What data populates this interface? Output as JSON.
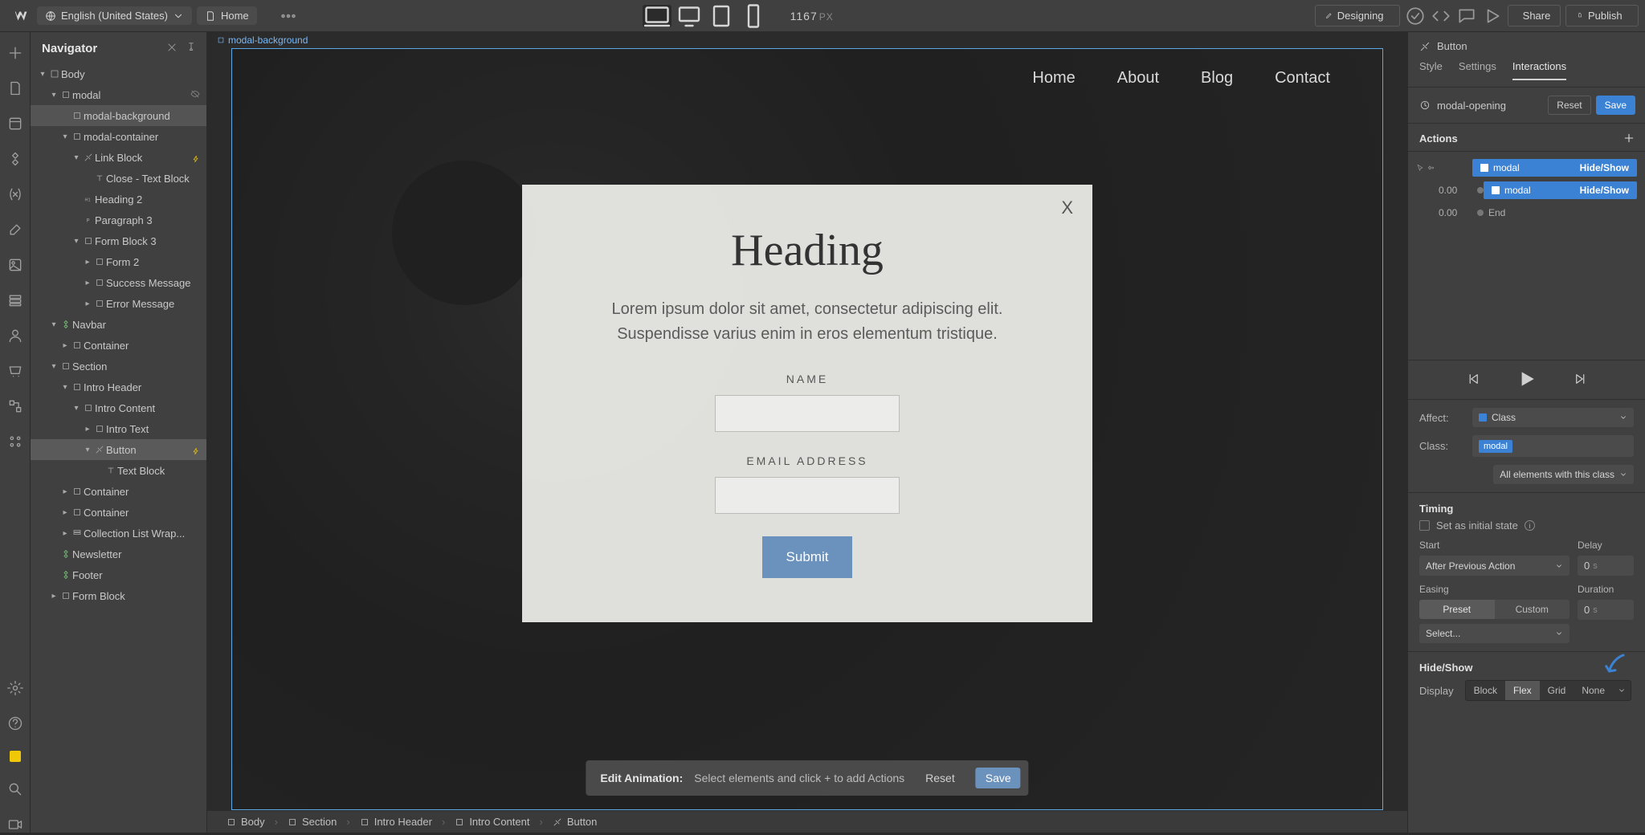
{
  "topbar": {
    "locale": "English (United States)",
    "page": "Home",
    "viewport_px": "1167",
    "viewport_unit": "PX",
    "mode": "Designing",
    "share": "Share",
    "publish": "Publish"
  },
  "navigator": {
    "title": "Navigator"
  },
  "tree": [
    {
      "d": 0,
      "tw": "v",
      "icon": "body",
      "label": "Body"
    },
    {
      "d": 1,
      "tw": "v",
      "icon": "div",
      "label": "modal",
      "eye": true
    },
    {
      "d": 2,
      "tw": "",
      "icon": "div",
      "label": "modal-background",
      "sel": true
    },
    {
      "d": 2,
      "tw": "v",
      "icon": "div",
      "label": "modal-container"
    },
    {
      "d": 3,
      "tw": "v",
      "icon": "link",
      "label": "Link Block",
      "bolt": true
    },
    {
      "d": 4,
      "tw": "",
      "icon": "text",
      "label": "Close - Text Block"
    },
    {
      "d": 3,
      "tw": "",
      "icon": "h1",
      "label": "Heading 2"
    },
    {
      "d": 3,
      "tw": "",
      "icon": "p",
      "label": "Paragraph 3"
    },
    {
      "d": 3,
      "tw": "v",
      "icon": "div",
      "label": "Form Block 3"
    },
    {
      "d": 4,
      "tw": ">",
      "icon": "div",
      "label": "Form 2"
    },
    {
      "d": 4,
      "tw": ">",
      "icon": "div",
      "label": "Success Message"
    },
    {
      "d": 4,
      "tw": ">",
      "icon": "div",
      "label": "Error Message"
    },
    {
      "d": 1,
      "tw": "v",
      "icon": "sym",
      "label": "Navbar"
    },
    {
      "d": 2,
      "tw": ">",
      "icon": "div",
      "label": "Container"
    },
    {
      "d": 1,
      "tw": "v",
      "icon": "div",
      "label": "Section"
    },
    {
      "d": 2,
      "tw": "v",
      "icon": "div",
      "label": "Intro Header"
    },
    {
      "d": 3,
      "tw": "v",
      "icon": "div",
      "label": "Intro Content"
    },
    {
      "d": 4,
      "tw": ">",
      "icon": "div",
      "label": "Intro Text"
    },
    {
      "d": 4,
      "tw": "v",
      "icon": "link",
      "label": "Button",
      "hl": true,
      "bolt": true
    },
    {
      "d": 5,
      "tw": "",
      "icon": "text",
      "label": "Text Block"
    },
    {
      "d": 2,
      "tw": ">",
      "icon": "div",
      "label": "Container"
    },
    {
      "d": 2,
      "tw": ">",
      "icon": "div",
      "label": "Container"
    },
    {
      "d": 2,
      "tw": ">",
      "icon": "list",
      "label": "Collection List Wrap..."
    },
    {
      "d": 1,
      "tw": "",
      "icon": "sym",
      "label": "Newsletter"
    },
    {
      "d": 1,
      "tw": "",
      "icon": "sym",
      "label": "Footer"
    },
    {
      "d": 1,
      "tw": ">",
      "icon": "div",
      "label": "Form Block"
    }
  ],
  "canvas": {
    "crumb": "modal-background",
    "site_nav": [
      "Home",
      "About",
      "Blog",
      "Contact"
    ],
    "modal": {
      "close": "X",
      "heading": "Heading",
      "paragraph": "Lorem ipsum dolor sit amet, consectetur adipiscing elit. Suspendisse varius enim in eros elementum tristique.",
      "name_label": "NAME",
      "email_label": "EMAIL ADDRESS",
      "submit": "Submit"
    },
    "edit_pill": {
      "label": "Edit Animation:",
      "hint": "Select elements and click + to add Actions",
      "reset": "Reset",
      "save": "Save"
    }
  },
  "bottom_crumbs": [
    "Body",
    "Section",
    "Intro Header",
    "Intro Content",
    "Button"
  ],
  "right": {
    "element": "Button",
    "tabs": {
      "style": "Style",
      "settings": "Settings",
      "interactions": "Interactions"
    },
    "animation_name": "modal-opening",
    "reset": "Reset",
    "save": "Save",
    "actions_title": "Actions",
    "actions": [
      {
        "time": "",
        "label": "modal",
        "type": "Hide/Show",
        "cursor": true
      },
      {
        "time": "0.00",
        "label": "modal",
        "type": "Hide/Show"
      },
      {
        "time": "0.00",
        "label": "End",
        "end": true
      }
    ],
    "affect_label": "Affect:",
    "affect_value": "Class",
    "class_label": "Class:",
    "class_value": "modal",
    "scope": "All elements with this class",
    "timing_title": "Timing",
    "initial_state": "Set as initial state",
    "start_label": "Start",
    "start_value": "After Previous Action",
    "delay_label": "Delay",
    "delay_value": "0",
    "delay_unit": "s",
    "easing_label": "Easing",
    "easing_preset": "Preset",
    "easing_custom": "Custom",
    "easing_value": "Select...",
    "duration_label": "Duration",
    "duration_value": "0",
    "duration_unit": "s",
    "hideshow_title": "Hide/Show",
    "display_label": "Display",
    "display_opts": [
      "Block",
      "Flex",
      "Grid",
      "None"
    ]
  }
}
